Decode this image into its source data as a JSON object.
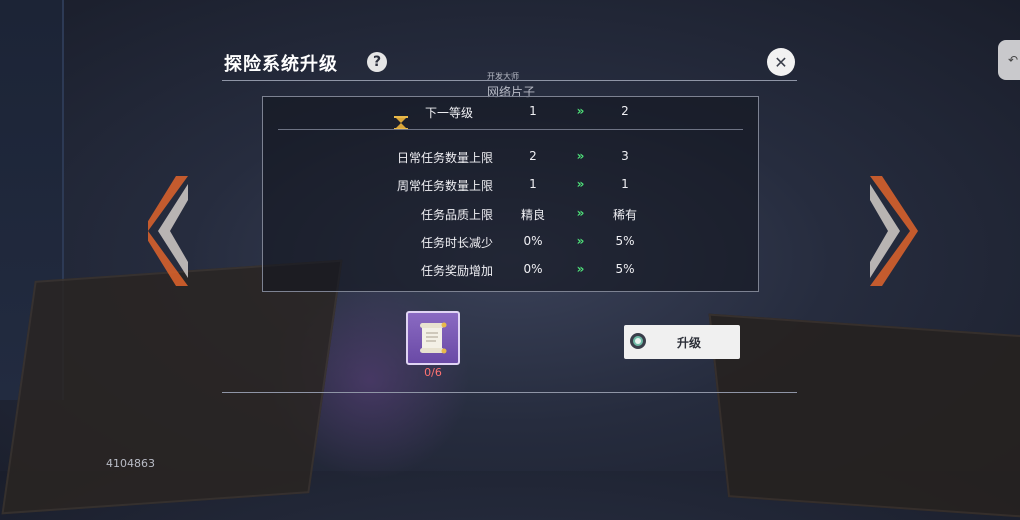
{
  "header": {
    "title": "探险系统升级",
    "help_symbol": "?",
    "close_symbol": "✕"
  },
  "watermark": {
    "top_line": "开发大师",
    "name": "网络片子"
  },
  "table": {
    "level_row": {
      "icon": "hourglass-icon",
      "label": "下一等级",
      "current": "1",
      "arrow": "»",
      "next": "2"
    },
    "rows": [
      {
        "label": "日常任务数量上限",
        "current": "2",
        "arrow": "»",
        "next": "3"
      },
      {
        "label": "周常任务数量上限",
        "current": "1",
        "arrow": "»",
        "next": "1"
      },
      {
        "label": "任务品质上限",
        "current": "精良",
        "arrow": "»",
        "next": "稀有"
      },
      {
        "label": "任务时长减少",
        "current": "0%",
        "arrow": "»",
        "next": "5%"
      },
      {
        "label": "任务奖励增加",
        "current": "0%",
        "arrow": "»",
        "next": "5%"
      }
    ]
  },
  "material": {
    "icon": "scroll-icon",
    "count": "0/6"
  },
  "upgrade_button": {
    "label": "升级"
  },
  "corner_button": {
    "symbol": "↶"
  },
  "player_id": "4104863",
  "colors": {
    "arrow_green": "#4fe27a",
    "count_red": "#ff7272",
    "slot_purple": "#7a5ab6",
    "nav_orange": "#e0642c"
  }
}
